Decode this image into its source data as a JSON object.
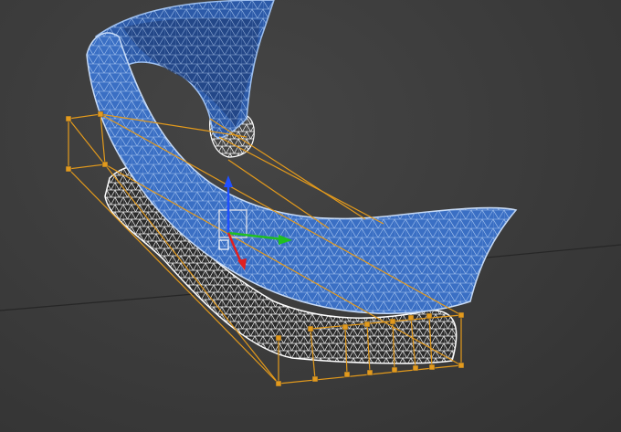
{
  "viewport": {
    "background_color": "#3b3b3b",
    "grid_line_color": "#2a2a2a",
    "wire_blue_color": "#3a6fc4",
    "wire_blue_line_color": "#9ec0f0",
    "wire_white_color": "#ffffff",
    "lattice_color": "#e39a1c",
    "gizmo_x_color": "#e02020",
    "gizmo_y_color": "#20c020",
    "gizmo_z_color": "#2050ff"
  },
  "scene_objects": {
    "bumper_upper": "wireframe-blue-mesh",
    "bumper_lower": "wireframe-white-mesh",
    "ffd_lattice": "orange-control-lattice",
    "transform_gizmo": "move-gizmo"
  }
}
